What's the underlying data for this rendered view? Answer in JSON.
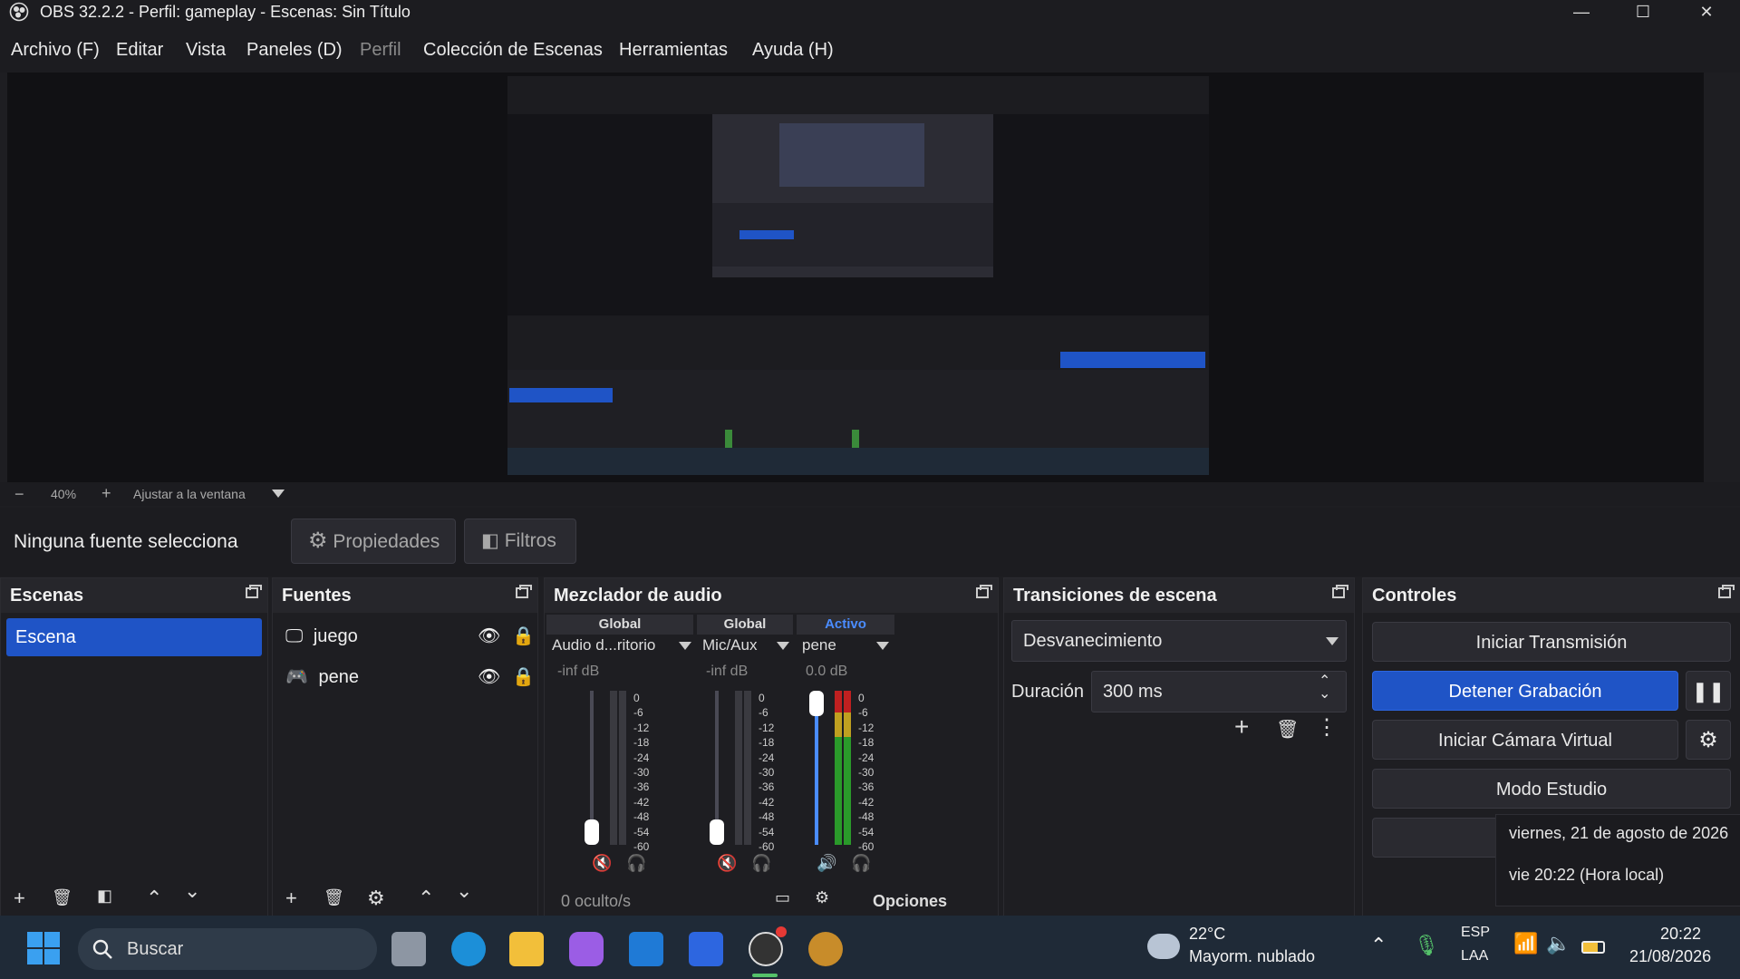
{
  "window": {
    "title": "OBS 32.2.2 - Perfil: gameplay - Escenas: Sin Título"
  },
  "menu": [
    "Archivo (F)",
    "Editar",
    "Vista",
    "Paneles (D)",
    "Perfil",
    "Colección de Escenas",
    "Herramientas",
    "Ayuda (H)"
  ],
  "zoom": {
    "minus": "−",
    "value": "40%",
    "plus": "+",
    "fit": "Ajustar a la ventana"
  },
  "source_bar": {
    "no_selection": "Ninguna fuente selecciona",
    "properties": "Propiedades",
    "filters": "Filtros"
  },
  "scenes": {
    "title": "Escenas",
    "items": [
      "Escena"
    ]
  },
  "sources": {
    "title": "Fuentes",
    "items": [
      {
        "name": "juego",
        "icon": "monitor-icon"
      },
      {
        "name": "pene",
        "icon": "gamepad-icon"
      }
    ]
  },
  "mixer": {
    "title": "Mezclador de audio",
    "channels": [
      {
        "tag": "Global",
        "name": "Audio d...ritorio",
        "db": "-inf dB",
        "muted": true
      },
      {
        "tag": "Global",
        "name": "Mic/Aux",
        "db": "-inf dB",
        "muted": true
      },
      {
        "tag": "Activo",
        "name": "pene",
        "db": "0.0 dB",
        "muted": false
      }
    ],
    "scale": [
      "0",
      "-6",
      "-12",
      "-18",
      "-24",
      "-30",
      "-36",
      "-42",
      "-48",
      "-54",
      "-60"
    ],
    "hidden": "0 oculto/s",
    "options": "Opciones",
    "active_color": "#4a8cff"
  },
  "transitions": {
    "title": "Transiciones de escena",
    "selected": "Desvanecimiento",
    "duration_label": "Duración",
    "duration_value": "300 ms"
  },
  "controls": {
    "title": "Controles",
    "start_stream": "Iniciar Transmisión",
    "stop_record": "Detener Grabación",
    "start_vcam": "Iniciar Cámara Virtual",
    "studio": "Modo Estudio",
    "accent": "#1f54c6"
  },
  "tooltip": {
    "line1": "viernes, 21 de agosto de 2026",
    "line2": "vie 20:22 (Hora local)"
  },
  "taskbar": {
    "search": "Buscar",
    "weather_temp": "22°C",
    "weather_desc": "Mayorm. nublado",
    "lang1": "ESP",
    "lang2": "LAA",
    "time": "20:22",
    "date": "21/08/2026"
  }
}
